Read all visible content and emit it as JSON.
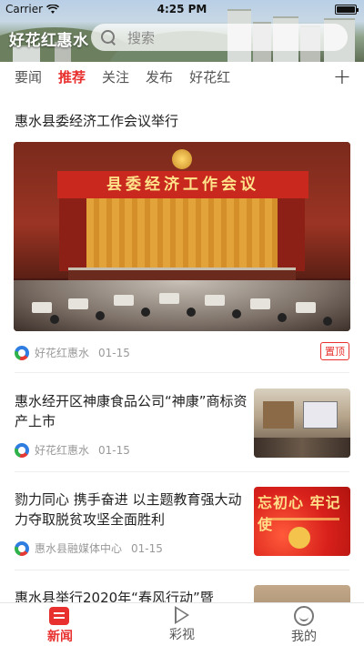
{
  "status_bar": {
    "carrier": "Carrier",
    "time": "4:25 PM"
  },
  "header": {
    "app_title": "好花红惠水",
    "search_placeholder": "搜索"
  },
  "tabs": [
    {
      "label": "要闻",
      "active": false
    },
    {
      "label": "推荐",
      "active": true
    },
    {
      "label": "关注",
      "active": false
    },
    {
      "label": "发布",
      "active": false
    },
    {
      "label": "好花红",
      "active": false
    }
  ],
  "tab_add_icon": "plus-icon",
  "feed": {
    "featured": {
      "title": "惠水县委经济工作会议举行",
      "image_banner": "县委经济工作会议",
      "source": "好花红惠水",
      "date": "01-15",
      "badge": "置顶"
    },
    "items": [
      {
        "title": "惠水经开区神康食品公司“神康”商标资产上市",
        "source": "好花红惠水",
        "date": "01-15"
      },
      {
        "title": "勠力同心 携手奋进 以主题教育强大动力夺取脱贫攻坚全面胜利",
        "source": "惠水县融媒体中心",
        "date": "01-15",
        "thumb_text": "忘初心 牢记使"
      },
      {
        "title": "惠水县举行2020年“春风行动”暨"
      }
    ]
  },
  "bottom_nav": [
    {
      "label": "新闻",
      "icon": "news-icon",
      "active": true
    },
    {
      "label": "彩视",
      "icon": "play-icon",
      "active": false
    },
    {
      "label": "我的",
      "icon": "smiley-icon",
      "active": false
    }
  ],
  "colors": {
    "accent": "#e8312f",
    "text": "#222222",
    "muted": "#999999"
  }
}
